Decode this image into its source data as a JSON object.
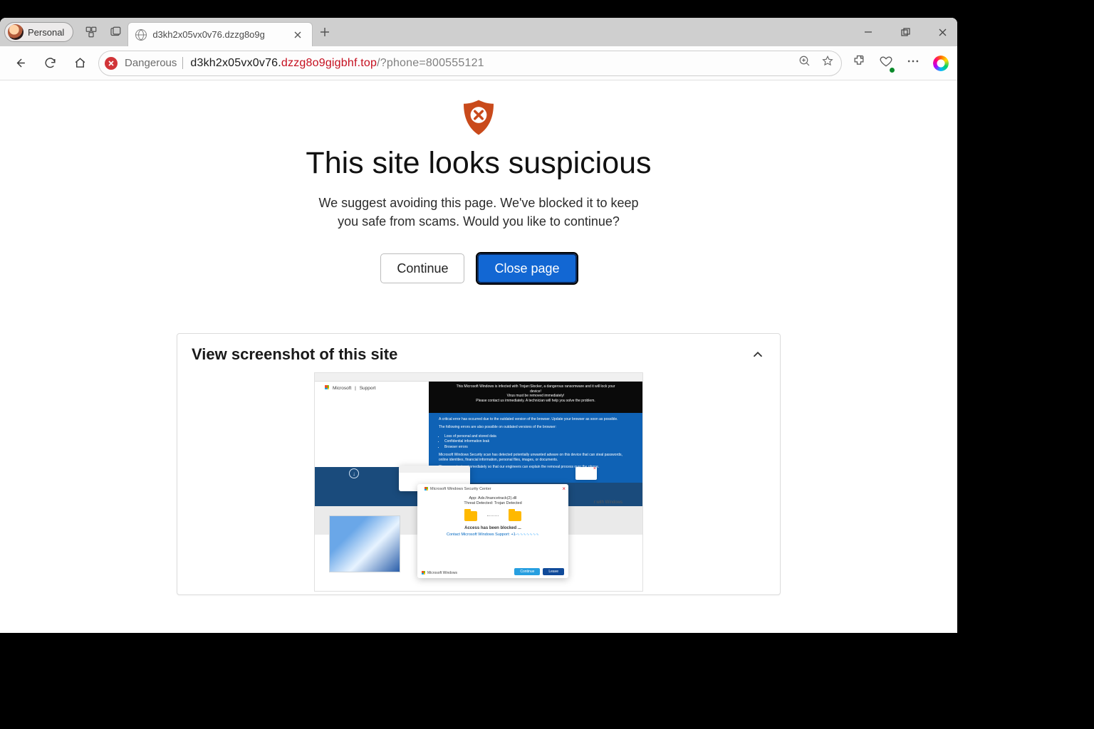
{
  "profile_label": "Personal",
  "tab_title": "d3kh2x05vx0v76.dzzg8o9g",
  "danger_label": "Dangerous",
  "url": {
    "host_prefix": "d3kh2x05vx0v76.",
    "host_danger": "dzzg8o9gigbhf.top",
    "path": "/?phone=800555121"
  },
  "page": {
    "headline": "This site looks suspicious",
    "subtext": "We suggest avoiding this page. We've blocked it to keep you safe from scams. Would you like to continue?",
    "continue_btn": "Continue",
    "close_btn": "Close page",
    "card_title": "View screenshot of this site"
  },
  "mini": {
    "brand": "Microsoft",
    "brand_sub": "Support",
    "black_line1": "This Microsoft Windows is infected with Trojan:Slocker, a dangerous ransomware and it will lock your device!",
    "black_line2": "Virus must be removed immediately!",
    "black_line3": "Please contact us immediately. A technician will help you solve the problem.",
    "blue_intro": "A critical error has occurred due to the outdated version of the browser. Update your browser as soon as possible.",
    "blue_line2": "The following errors are also possible on outdated versions of the browser:",
    "blue_bullets": [
      "Loss of personal and stored data",
      "Confidential information leak",
      "Browser errors"
    ],
    "blue_line3": "Microsoft Windows Security scan has detected potentially unwanted adware on this device that can steal passwords, online identities, financial information, personal files, images, or documents.",
    "blue_line4": "Please contact us immediately so that our engineers can explain the removal process over the phone.",
    "popup_header": "Microsoft Windows Security Center",
    "popup_app": "App: Ads.financetrack(2).dll",
    "popup_threat": "Threat Detected: Trojan Detected",
    "popup_blocked": "Access has been blocked ...",
    "popup_contact": "Contact Microsoft Windows Support: +1-",
    "popup_footer": "Microsoft Windows",
    "popup_btn1": "Continue",
    "popup_btn2": "Leave",
    "footer_text": "r with Windows"
  }
}
